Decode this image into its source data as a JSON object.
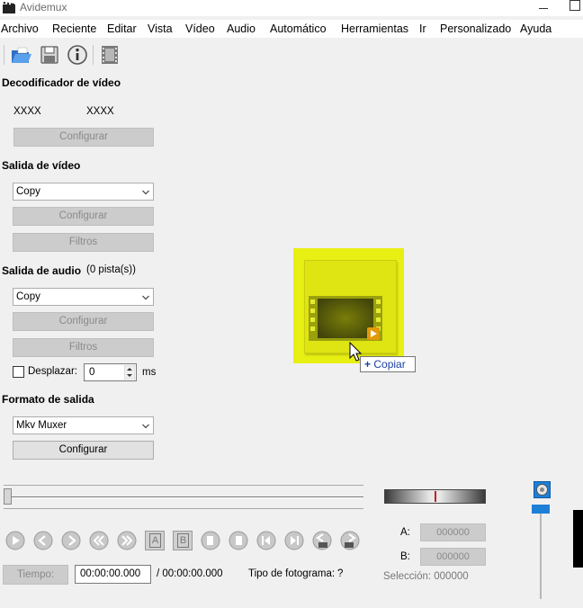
{
  "window": {
    "title": "Avidemux"
  },
  "menu": [
    "Archivo",
    "Reciente",
    "Editar",
    "Vista",
    "Vídeo",
    "Audio",
    "Automático",
    "Herramientas",
    "Ir",
    "Personalizado",
    "Ayuda"
  ],
  "toolbar": {
    "icons": [
      "open-folder-icon",
      "save-icon",
      "info-icon",
      "film-properties-icon"
    ]
  },
  "video_decoder": {
    "title": "Decodificador de vídeo",
    "value_left": "XXXX",
    "value_right": "XXXX",
    "configure_label": "Configurar"
  },
  "video_output": {
    "title": "Salida de vídeo",
    "codec": "Copy",
    "configure_label": "Configurar",
    "filters_label": "Filtros"
  },
  "audio_output": {
    "title": "Salida de audio",
    "tracks": "(0 pista(s))",
    "codec": "Copy",
    "configure_label": "Configurar",
    "filters_label": "Filtros",
    "shift_label": "Desplazar:",
    "shift_value": "0",
    "shift_unit": "ms",
    "shift_checked": false
  },
  "output_format": {
    "title": "Formato de salida",
    "muxer": "Mkv Muxer",
    "configure_label": "Configurar"
  },
  "drag_tooltip": {
    "symbol": "+",
    "label": "Copiar"
  },
  "playback": {
    "time_button": "Tiempo:",
    "current_time": "00:00:00.000",
    "total_time": "/ 00:00:00.000",
    "frame_type_label": "Tipo de fotograma:",
    "frame_type_value": "?",
    "marker_a_label": "A:",
    "marker_a_value": "000000",
    "marker_b_label": "B:",
    "marker_b_value": "000000",
    "selection_label": "Selección: 000000",
    "ab_a": "A",
    "ab_b": "B"
  },
  "colors": {
    "preview_bg": "#e8ef12",
    "accent_blue": "#1e7fd6",
    "jog_red": "#c0202a"
  }
}
